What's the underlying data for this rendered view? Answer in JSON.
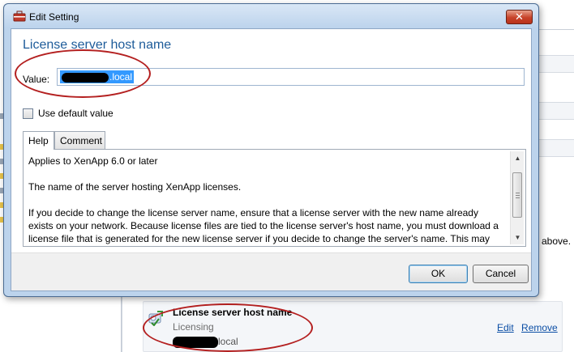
{
  "dialog": {
    "title": "Edit Setting",
    "close_label": "✕",
    "heading": "License server host name",
    "value_label": "Value:",
    "value_text": ".local",
    "use_default_label": "Use default value",
    "use_default_checked": false,
    "tabs": [
      {
        "label": "Help",
        "active": true
      },
      {
        "label": "Comment",
        "active": false
      }
    ],
    "help_paragraphs": [
      "Applies to XenApp 6.0 or later",
      "The name of the server hosting XenApp licenses.",
      "If you decide to change the license server name, ensure that a license server with the new name already exists on your network. Because license files are tied to the license server's host name, you must download a license file that is generated for the new license server if you decide to change the server's name. This may involve"
    ],
    "ok_label": "OK",
    "cancel_label": "Cancel"
  },
  "background": {
    "above_text": "above.",
    "setting_card": {
      "title": "License server host name",
      "category": "Licensing",
      "value_text": "local",
      "edit_label": "Edit",
      "remove_label": "Remove"
    }
  },
  "colors": {
    "annotation_ring": "#b42020",
    "heading": "#1e5c9a",
    "link": "#0b4ea5",
    "selection": "#3399ff"
  }
}
